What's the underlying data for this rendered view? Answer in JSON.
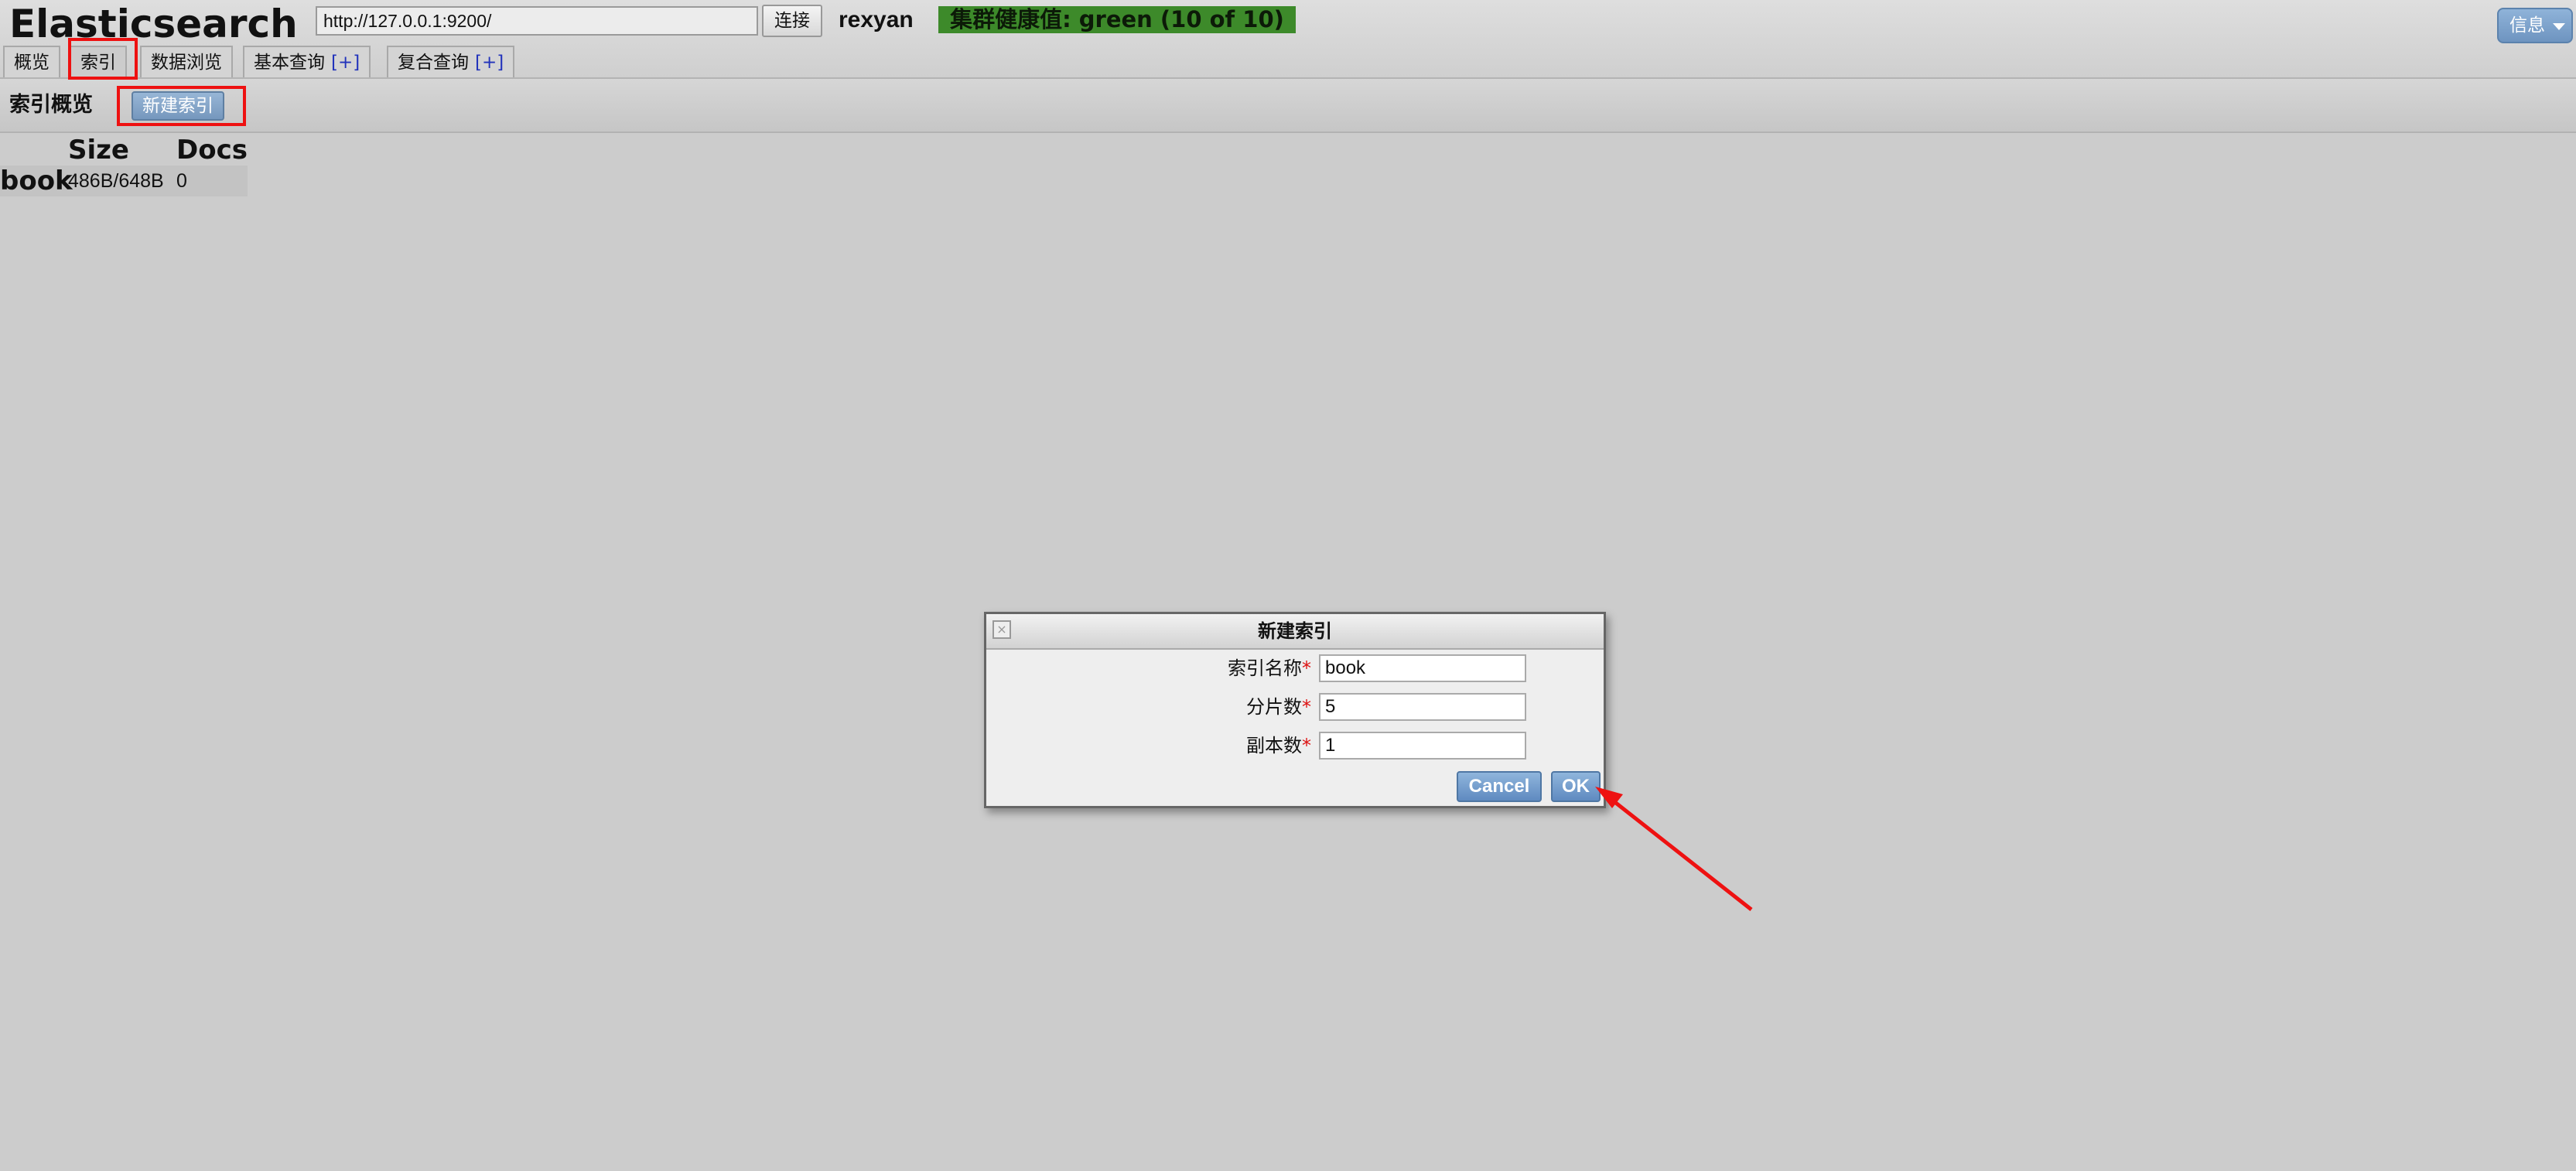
{
  "header": {
    "app_title": "Elasticsearch",
    "url_value": "http://127.0.0.1:9200/",
    "connect_label": "连接",
    "cluster_name": "rexyan",
    "health_text": "集群健康值: green (10 of 10)",
    "info_label": "信息"
  },
  "tabs": [
    {
      "label": "概览"
    },
    {
      "label": "索引"
    },
    {
      "label": "数据浏览"
    },
    {
      "label": "基本查询",
      "plus": "[+]"
    },
    {
      "label": "复合查询",
      "plus": "[+]"
    }
  ],
  "index_overview": {
    "title": "索引概览",
    "new_index_label": "新建索引",
    "columns": [
      "Size",
      "Docs"
    ],
    "rows": [
      {
        "name": "book",
        "size": "486B/648B",
        "docs": "0"
      }
    ]
  },
  "dialog": {
    "title": "新建索引",
    "close_icon": "close-icon",
    "fields": [
      {
        "label": "索引名称",
        "required_mark": "*",
        "value": "book"
      },
      {
        "label": "分片数",
        "required_mark": "*",
        "value": "5"
      },
      {
        "label": "副本数",
        "required_mark": "*",
        "value": "1"
      }
    ],
    "cancel_label": "Cancel",
    "ok_label": "OK"
  },
  "colors": {
    "background": "#cccccc",
    "health_green": "#3d8a2a",
    "button_blue": "#7597bd",
    "highlight_red": "#ee1111"
  }
}
